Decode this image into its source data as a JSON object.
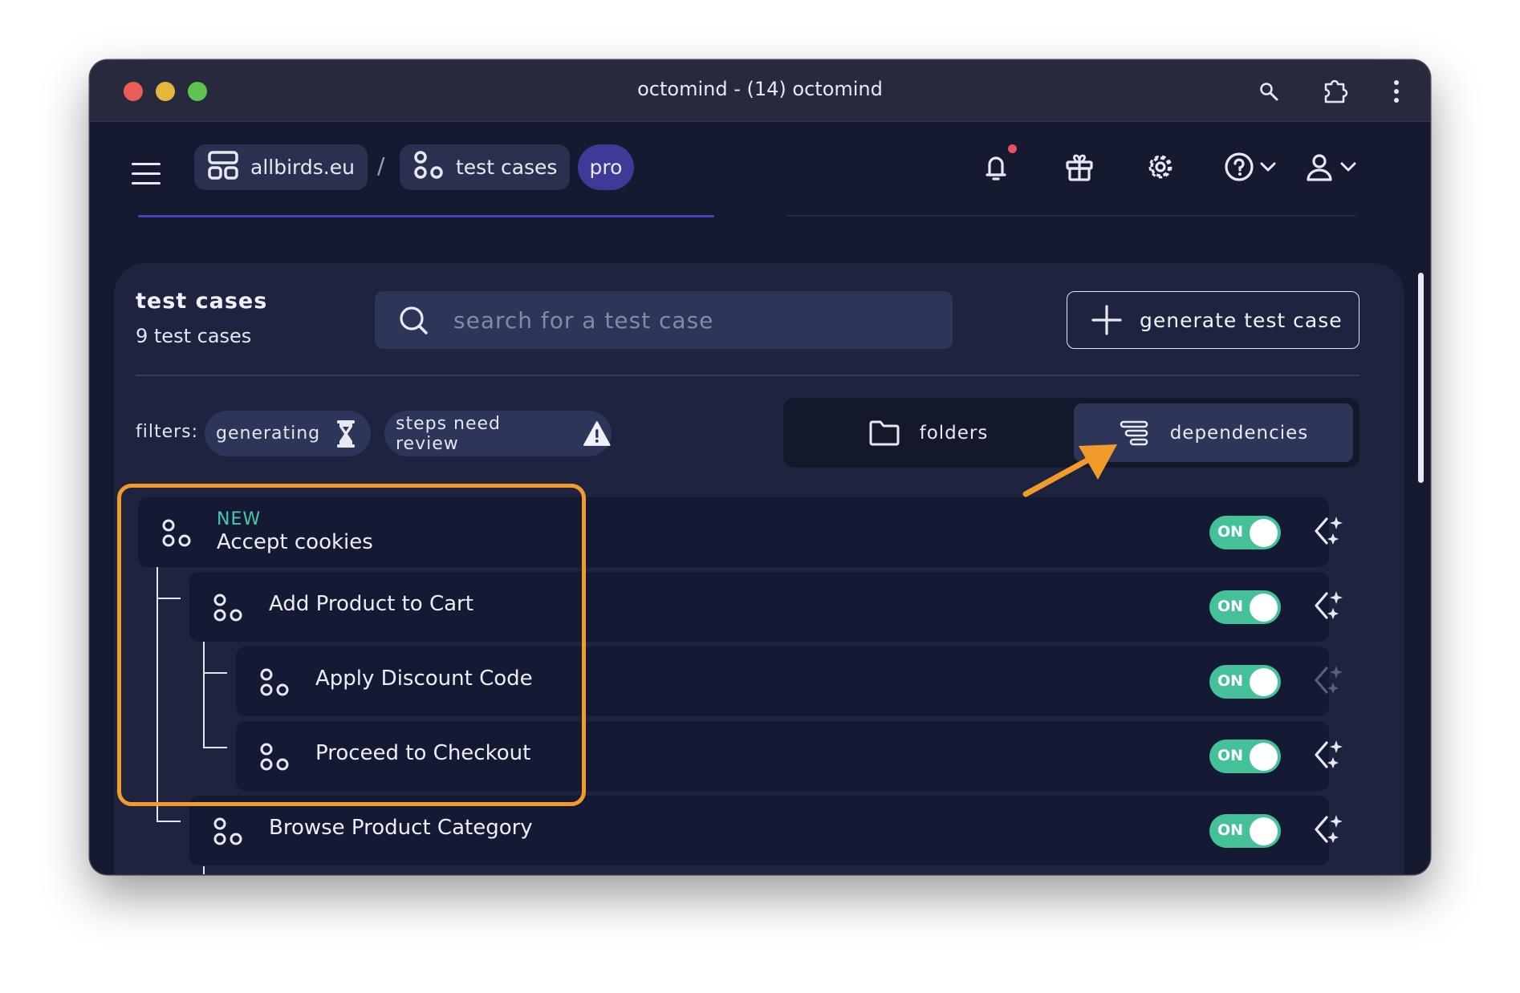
{
  "window": {
    "title": "octomind - (14) octomind"
  },
  "nav": {
    "project": "allbirds.eu",
    "separator": "/",
    "section": "test cases",
    "plan_badge": "pro"
  },
  "panel": {
    "title": "test cases",
    "count": "9 test cases",
    "search_placeholder": "search for a test case",
    "generate_label": "generate test case"
  },
  "filters": {
    "label": "filters:",
    "chips": [
      "generating",
      "steps need review"
    ]
  },
  "view_toggle": {
    "folders": "folders",
    "dependencies": "dependencies",
    "selected": "dependencies"
  },
  "tests": [
    {
      "new_tag": "NEW",
      "name": "Accept cookies",
      "toggle": "ON"
    },
    {
      "name": "Add Product to Cart",
      "toggle": "ON"
    },
    {
      "name": "Apply Discount Code",
      "toggle": "ON"
    },
    {
      "name": "Proceed to Checkout",
      "toggle": "ON"
    },
    {
      "name": "Browse Product Category",
      "toggle": "ON"
    }
  ],
  "colors": {
    "accent_highlight": "#f29b2a",
    "toggle_on": "#45c19a",
    "new_tag": "#47c8a8",
    "pro_badge": "#3f3a98"
  },
  "icons": [
    "search-icon",
    "plus-icon",
    "hourglass-icon",
    "warning-icon",
    "folder-icon",
    "dependencies-icon",
    "bell-icon",
    "gift-icon",
    "gear-icon",
    "help-icon",
    "user-icon",
    "sparkle-icon",
    "test-case-icon"
  ]
}
